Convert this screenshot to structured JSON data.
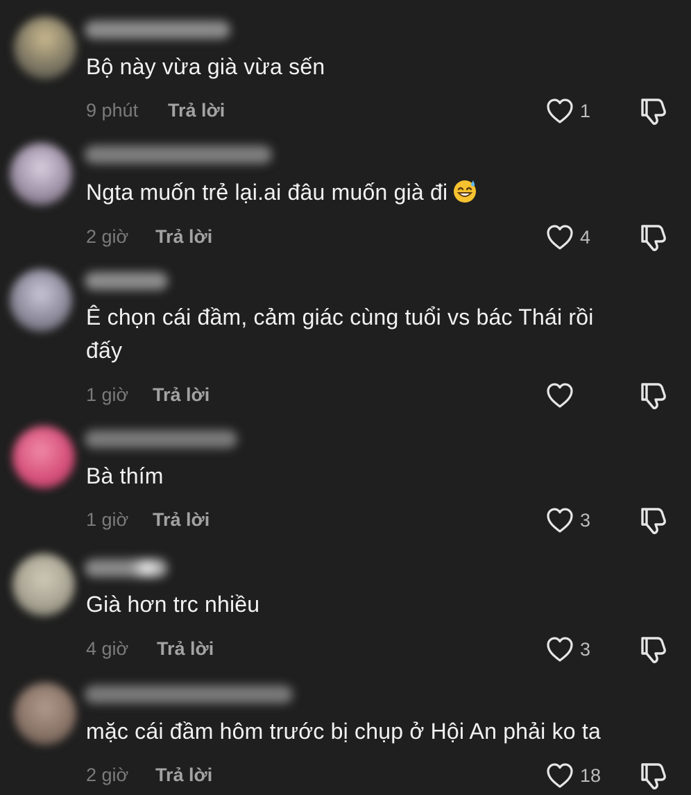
{
  "comments": [
    {
      "text": "Bộ này vừa già vừa sến",
      "time": "9 phút",
      "reply_label": "Trả lời",
      "likes": "1",
      "avatar_color": "#8a7f6a",
      "username_color": "#9a9a9a"
    },
    {
      "text": "Ngta muốn trẻ lại.ai đâu muốn già đi",
      "emoji": "sweat-smile-emoji",
      "time": "2 giờ",
      "reply_label": "Trả lời",
      "likes": "4",
      "avatar_color": "#9a8e9e",
      "username_color": "#8a8a8a"
    },
    {
      "text_line1": "Ê chọn cái đầm, cảm giác cùng tuổi vs bác Thái rồi",
      "text_line2": "đấy",
      "time": "1 giờ",
      "reply_label": "Trả lời",
      "likes": "",
      "avatar_color": "#8e8a9a",
      "username_color": "#9a9a9a"
    },
    {
      "text": "Bà thím",
      "time": "1 giờ",
      "reply_label": "Trả lời",
      "likes": "3",
      "avatar_color": "#d9577a",
      "username_color": "#8a8a8a"
    },
    {
      "text": "Già hơn trc nhiều",
      "time": "4 giờ",
      "reply_label": "Trả lời",
      "likes": "3",
      "avatar_color": "#b0ab9c",
      "username_color": "#a8a8a8"
    },
    {
      "text": "mặc cái đầm hôm trước bị chụp ở Hội An phải ko ta",
      "time": "2 giờ",
      "reply_label": "Trả lời",
      "likes": "18",
      "avatar_color": "#8a7468",
      "username_color": "#8a8a8a"
    }
  ],
  "icons": {
    "like": "heart-outline-icon",
    "dislike": "thumbs-down-outline-icon"
  }
}
